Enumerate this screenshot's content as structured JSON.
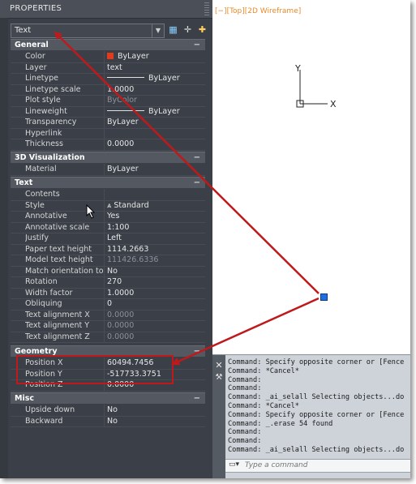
{
  "palette": {
    "title": "PROPERTIES",
    "selector_value": "Text",
    "toolbar_icons": [
      "quick-select-icon",
      "select-objects-icon",
      "toggle-pickadd-icon"
    ],
    "categories": [
      {
        "label": "General",
        "toggle": "−",
        "rows": [
          {
            "name": "Color",
            "value": "ByLayer",
            "kind": "swatch",
            "swatch_color": "#e23b1a"
          },
          {
            "name": "Layer",
            "value": "text"
          },
          {
            "name": "Linetype",
            "value": "ByLayer",
            "kind": "line"
          },
          {
            "name": "Linetype scale",
            "value": "1.0000"
          },
          {
            "name": "Plot style",
            "value": "ByColor",
            "dim": true
          },
          {
            "name": "Lineweight",
            "value": "ByLayer",
            "kind": "line"
          },
          {
            "name": "Transparency",
            "value": "ByLayer"
          },
          {
            "name": "Hyperlink",
            "value": ""
          },
          {
            "name": "Thickness",
            "value": "0.0000"
          }
        ]
      },
      {
        "label": "3D Visualization",
        "toggle": "−",
        "rows": [
          {
            "name": "Material",
            "value": "ByLayer"
          }
        ]
      },
      {
        "label": "Text",
        "toggle": "−",
        "rows": [
          {
            "name": "Contents",
            "value": ""
          },
          {
            "name": "Style",
            "value": "Standard",
            "kind": "style"
          },
          {
            "name": "Annotative",
            "value": "Yes"
          },
          {
            "name": "Annotative scale",
            "value": "1:100"
          },
          {
            "name": "Justify",
            "value": "Left"
          },
          {
            "name": "Paper text height",
            "value": "1114.2663"
          },
          {
            "name": "Model text height",
            "value": "111426.6336",
            "dim": true
          },
          {
            "name": "Match orientation to la...",
            "value": "No"
          },
          {
            "name": "Rotation",
            "value": "270"
          },
          {
            "name": "Width factor",
            "value": "1.0000"
          },
          {
            "name": "Obliquing",
            "value": "0"
          },
          {
            "name": "Text alignment X",
            "value": "0.0000",
            "dim": true
          },
          {
            "name": "Text alignment Y",
            "value": "0.0000",
            "dim": true
          },
          {
            "name": "Text alignment Z",
            "value": "0.0000",
            "dim": true
          }
        ]
      },
      {
        "label": "Geometry",
        "toggle": "−",
        "rows": [
          {
            "name": "Position X",
            "value": "60494.7456"
          },
          {
            "name": "Position Y",
            "value": "-517733.3751"
          },
          {
            "name": "Position Z",
            "value": "0.0000"
          }
        ]
      },
      {
        "label": "Misc",
        "toggle": "−",
        "rows": [
          {
            "name": "Upside down",
            "value": "No"
          },
          {
            "name": "Backward",
            "value": "No"
          }
        ]
      }
    ]
  },
  "viewport": {
    "label": "[−][Top][2D Wireframe]",
    "ucs_x_label": "X",
    "ucs_y_label": "Y"
  },
  "command": {
    "lines": [
      "Command: Specify opposite corner or [Fence",
      "Command: *Cancel*",
      "Command:",
      "Command:",
      "Command: _ai_selall Selecting objects...do",
      "Command: *Cancel*",
      "Command: Specify opposite corner or [Fence",
      "Command: _.erase 54 found",
      "Command:",
      "Command:",
      "Command: _ai_selall Selecting objects...do"
    ],
    "placeholder": "Type a command"
  },
  "colors": {
    "accent_arrow": "#c0191c",
    "viewport_label": "#e88a2a",
    "grip": "#1e6fe0"
  }
}
